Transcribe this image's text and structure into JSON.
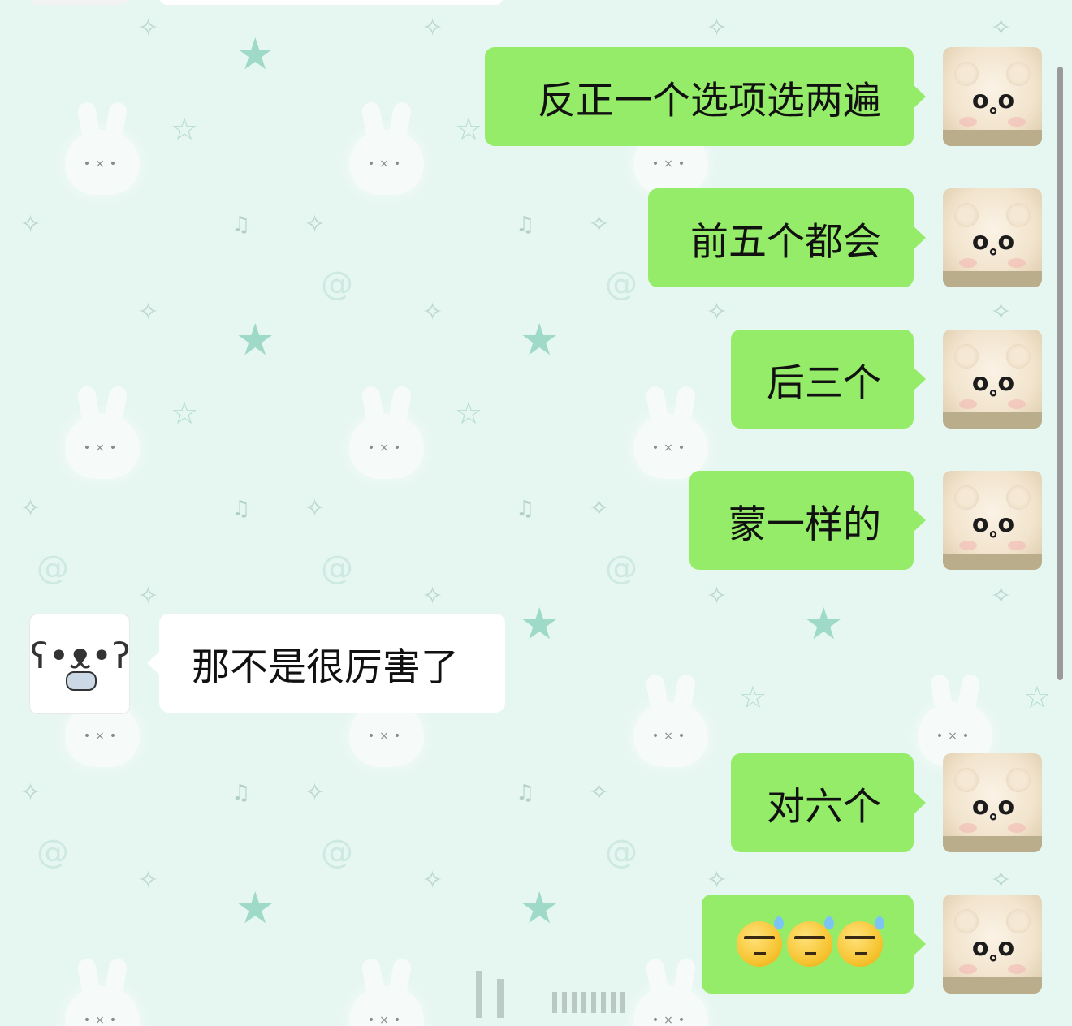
{
  "chat": {
    "messages": [
      {
        "from": "me",
        "text": "反正一个选项选两遍"
      },
      {
        "from": "me",
        "text": "前五个都会"
      },
      {
        "from": "me",
        "text": "后三个"
      },
      {
        "from": "me",
        "text": "蒙一样的"
      },
      {
        "from": "them",
        "text": "那不是很厉害了"
      },
      {
        "from": "me",
        "text": "对六个"
      },
      {
        "from": "me",
        "emoji": [
          "sweat-eye-roll-emoji",
          "sweat-eye-roll-emoji",
          "sweat-eye-roll-emoji"
        ]
      }
    ]
  },
  "colors": {
    "background": "#e6f6f1",
    "my_bubble": "#95ec69",
    "their_bubble": "#ffffff"
  },
  "icons": {
    "my_avatar": "plush-bear-avatar",
    "their_avatar": "puppy-guitar-avatar",
    "wallpaper": [
      "bunny",
      "star",
      "sparkle",
      "music-note",
      "swirl"
    ]
  }
}
